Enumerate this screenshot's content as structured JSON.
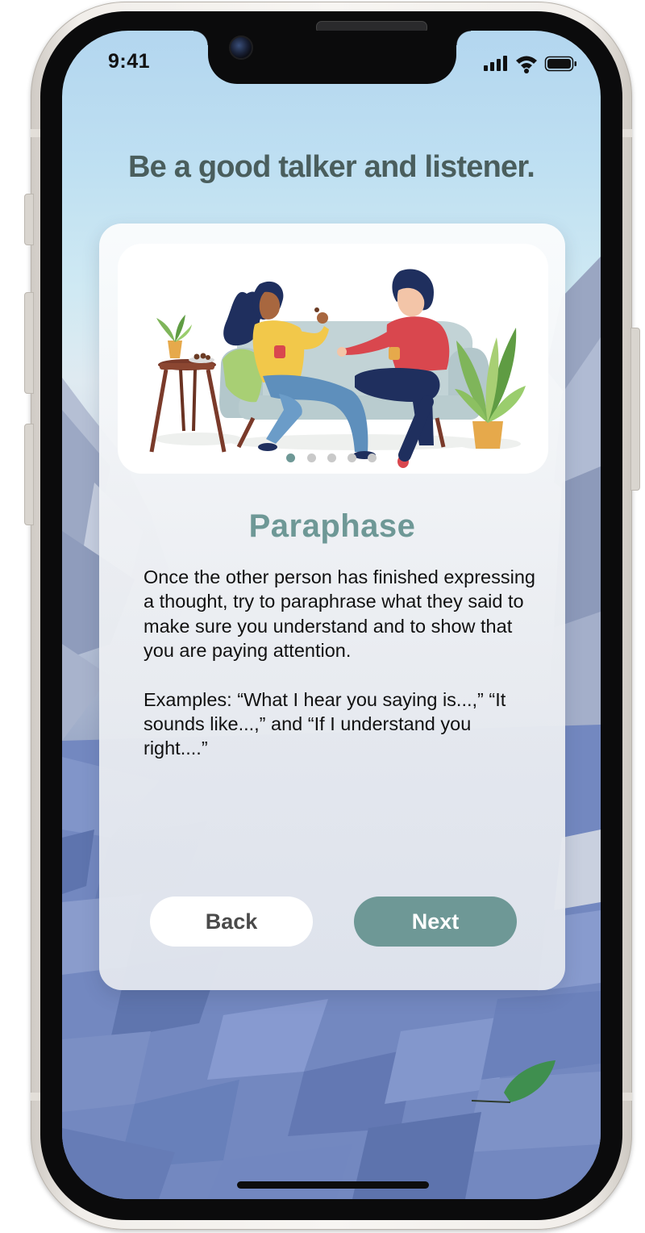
{
  "status_bar": {
    "time": "9:41",
    "icons": [
      "signal-icon",
      "wifi-icon",
      "battery-icon"
    ]
  },
  "headline": "Be a good talker and listener.",
  "card": {
    "illustration": "two-women-conversation-illustration",
    "pagination": {
      "total": 5,
      "active_index": 0
    },
    "title": "Paraphase",
    "paragraphs": [
      "Once the other person has finished expressing a thought, try to paraphrase what they said to make sure you understand and to show that you are paying attention.",
      "Examples: “What I hear you saying is...,” “It sounds like...,” and “If I understand you right....”"
    ]
  },
  "buttons": {
    "back_label": "Back",
    "next_label": "Next"
  },
  "colors": {
    "accent": "#6e9896",
    "headline": "#4a5e5d",
    "card_bg": "#eef0f4"
  }
}
